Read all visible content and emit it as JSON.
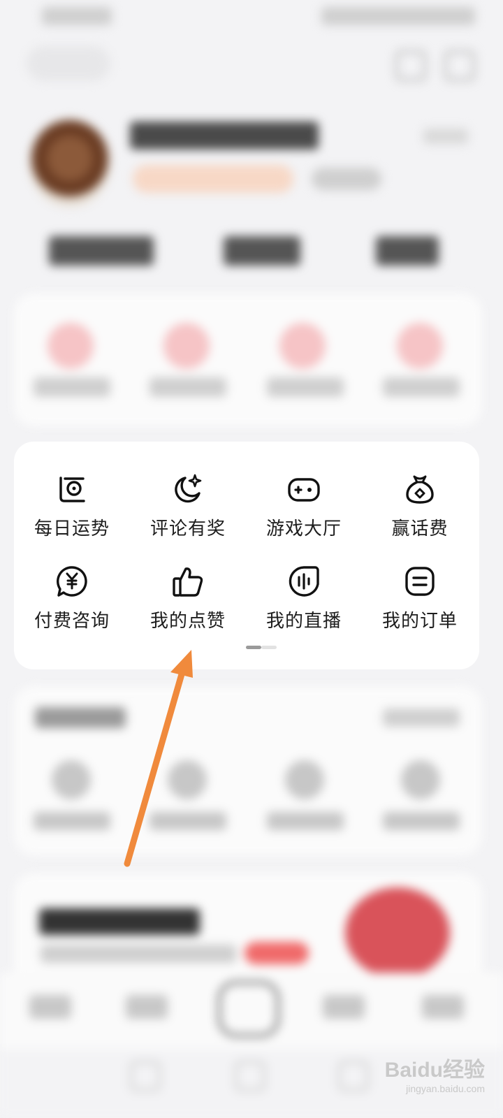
{
  "menu": {
    "row1": [
      {
        "label": "每日运势",
        "icon": "fortune-icon"
      },
      {
        "label": "评论有奖",
        "icon": "moon-star-icon"
      },
      {
        "label": "游戏大厅",
        "icon": "gamepad-icon"
      },
      {
        "label": "赢话费",
        "icon": "money-bag-icon"
      }
    ],
    "row2": [
      {
        "label": "付费咨询",
        "icon": "yuan-chat-icon"
      },
      {
        "label": "我的点赞",
        "icon": "thumbs-up-icon"
      },
      {
        "label": "我的直播",
        "icon": "live-icon"
      },
      {
        "label": "我的订单",
        "icon": "order-icon"
      }
    ],
    "page_indicator": {
      "pages": 2,
      "current": 1
    }
  },
  "annotation": {
    "color": "#f08a3c"
  },
  "watermark": {
    "brand": "Baidu经验",
    "url": "jingyan.baidu.com"
  }
}
